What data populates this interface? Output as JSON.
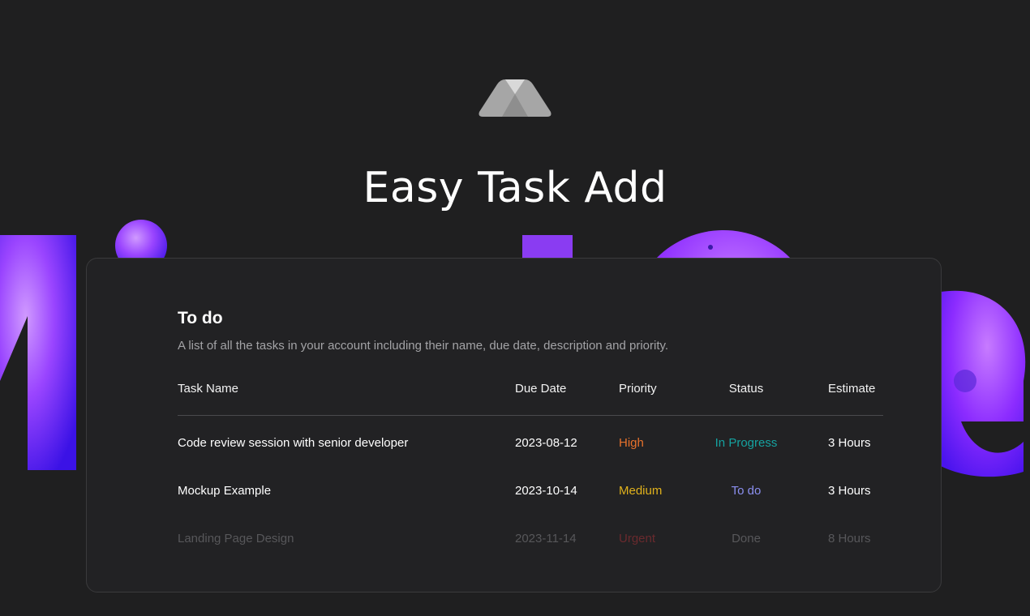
{
  "hero": {
    "title": "Easy Task Add"
  },
  "table": {
    "title": "To do",
    "description": "A list of all the tasks in your account including their name, due date, description and priority.",
    "columns": {
      "name": "Task Name",
      "due": "Due Date",
      "priority": "Priority",
      "status": "Status",
      "estimate": "Estimate"
    },
    "rows": [
      {
        "name": "Code review session with senior developer",
        "due": "2023-08-12",
        "priority": "High",
        "status": "In Progress",
        "estimate": "3 Hours"
      },
      {
        "name": "Mockup Example",
        "due": "2023-10-14",
        "priority": "Medium",
        "status": "To do",
        "estimate": "3 Hours"
      },
      {
        "name": "Landing Page Design",
        "due": "2023-11-14",
        "priority": "Urgent",
        "status": "Done",
        "estimate": "8 Hours"
      }
    ]
  },
  "colors": {
    "background": "#1f1f20",
    "card": "#222224",
    "priority_high": "#e8722c",
    "priority_medium": "#e1b21c",
    "priority_urgent": "#6a2a2e",
    "status_in_progress": "#15a2a0",
    "status_todo": "#8b8ff0",
    "status_done": "#5b5b5e",
    "accent_purple": "#7b2cff"
  }
}
